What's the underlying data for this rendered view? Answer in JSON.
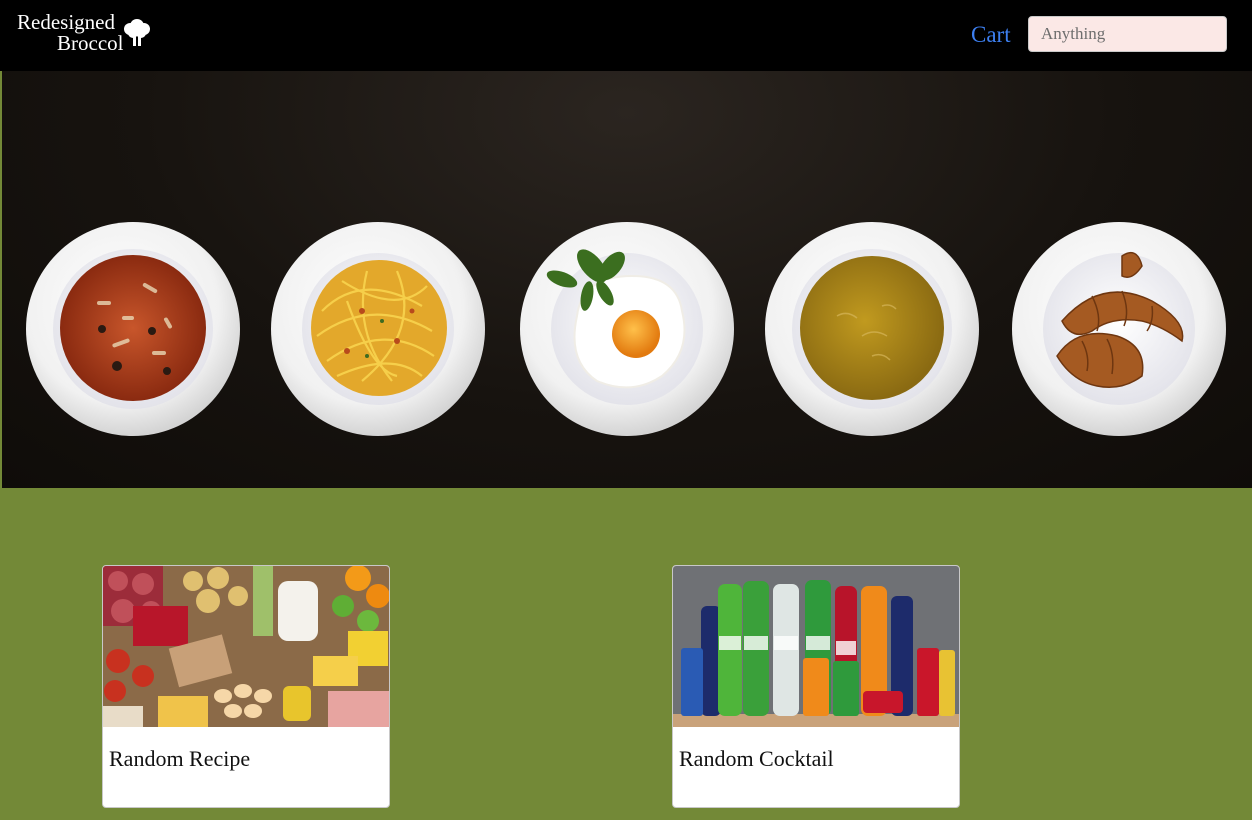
{
  "navbar": {
    "brand_line1": "Redesigned",
    "brand_line2": "Broccol",
    "cart_label": "Cart",
    "search_placeholder": "Anything"
  },
  "hero": {
    "dishes": [
      "soup-bowl",
      "spaghetti",
      "fried-egg",
      "cream-soup",
      "croissants"
    ]
  },
  "cards": [
    {
      "title": "Random Recipe"
    },
    {
      "title": "Random Cocktail"
    }
  ],
  "colors": {
    "navbar_bg": "#000000",
    "page_bg": "#738937",
    "link": "#3d7ff0",
    "search_bg": "#fbe8e6"
  }
}
